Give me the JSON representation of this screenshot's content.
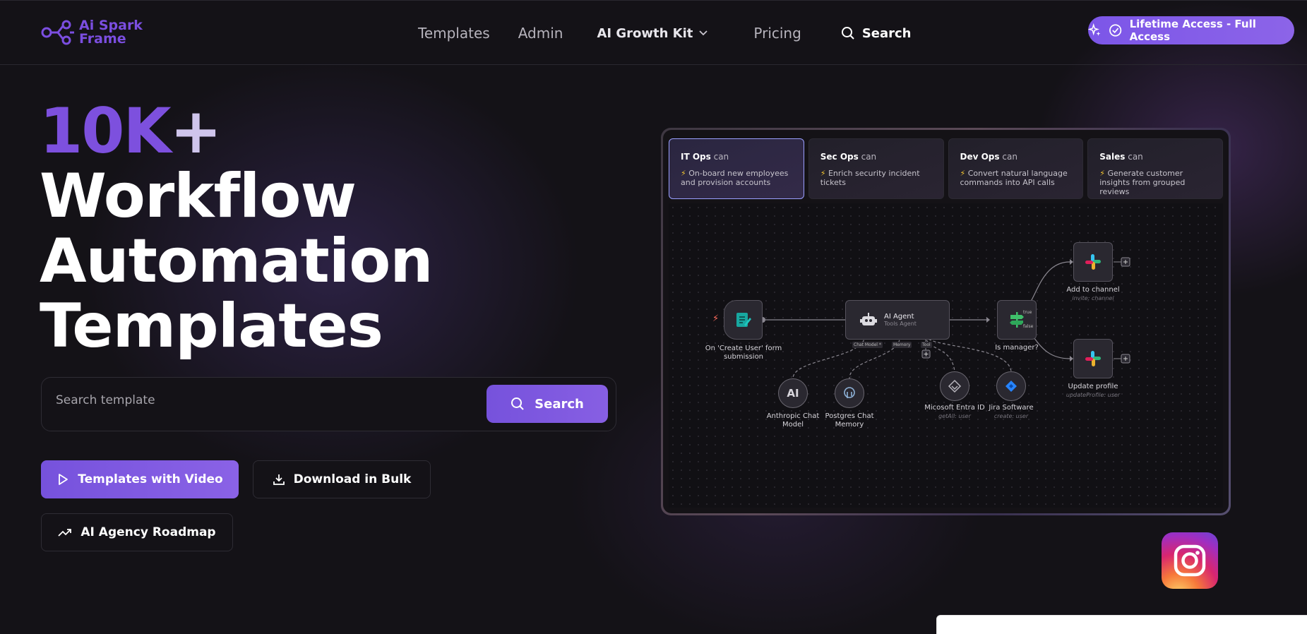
{
  "brand": {
    "name_line1": "Ai Spark",
    "name_line2": "Frame",
    "accent": "#7b4ee0"
  },
  "nav": {
    "templates": "Templates",
    "admin": "Admin",
    "growth_kit": "AI Growth Kit",
    "pricing": "Pricing",
    "search": "Search",
    "lifetime": "Lifetime Access - Full Access"
  },
  "hero": {
    "accent": "10K",
    "plus": "+",
    "line1": "Workflow",
    "line2": "Automation",
    "line3": "Templates"
  },
  "search": {
    "placeholder": "Search template",
    "value": "",
    "button": "Search"
  },
  "cta": {
    "video": "Templates with Video",
    "bulk": "Download in Bulk",
    "roadmap": "AI Agency Roadmap"
  },
  "workflow": {
    "tabs": [
      {
        "team": "IT Ops",
        "can": "can",
        "desc": "On-board new employees and provision accounts"
      },
      {
        "team": "Sec Ops",
        "can": "can",
        "desc": "Enrich security incident tickets"
      },
      {
        "team": "Dev Ops",
        "can": "can",
        "desc": "Convert natural language commands into API calls"
      },
      {
        "team": "Sales",
        "can": "can",
        "desc": "Generate customer insights from grouped reviews"
      }
    ],
    "nodes": {
      "trigger": "On 'Create User' form submission",
      "agent_title": "AI Agent",
      "agent_sub": "Tools Agent",
      "manager": "Is manager?",
      "add_channel": "Add to channel",
      "add_channel_sub": "invite: channel",
      "update_profile": "Update profile",
      "update_profile_sub": "updateProfile: user",
      "anthropic": "Anthropic Chat Model",
      "postgres": "Postgres Chat Memory",
      "entra": "Micosoft Entra ID",
      "entra_sub": "getAll: user",
      "jira": "Jira Software",
      "jira_sub": "create: user"
    },
    "ports": {
      "chat_model": "Chat Model *",
      "memory": "Memory",
      "tool": "Tool",
      "true": "true",
      "false": "false"
    }
  }
}
